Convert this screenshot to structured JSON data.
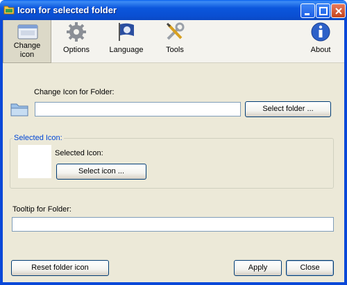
{
  "window": {
    "title": "Icon for selected folder"
  },
  "toolbar": {
    "items": [
      {
        "label_line1": "Change",
        "label_line2": "icon"
      },
      {
        "label": "Options"
      },
      {
        "label": "Language"
      },
      {
        "label": "Tools"
      },
      {
        "label": "About"
      }
    ]
  },
  "change_icon": {
    "label": "Change Icon for Folder:",
    "path_value": "",
    "select_folder_label": "Select folder ..."
  },
  "selected_icon_group": {
    "title": "Selected Icon:",
    "label": "Selected Icon:",
    "select_icon_label": "Select icon ..."
  },
  "tooltip": {
    "label": "Tooltip for Folder:",
    "value": ""
  },
  "footer": {
    "reset_label": "Reset folder icon",
    "apply_label": "Apply",
    "close_label": "Close"
  },
  "colors": {
    "titlebar": "#0a4fd2",
    "face": "#ece9d8",
    "group_title": "#0046d5"
  }
}
